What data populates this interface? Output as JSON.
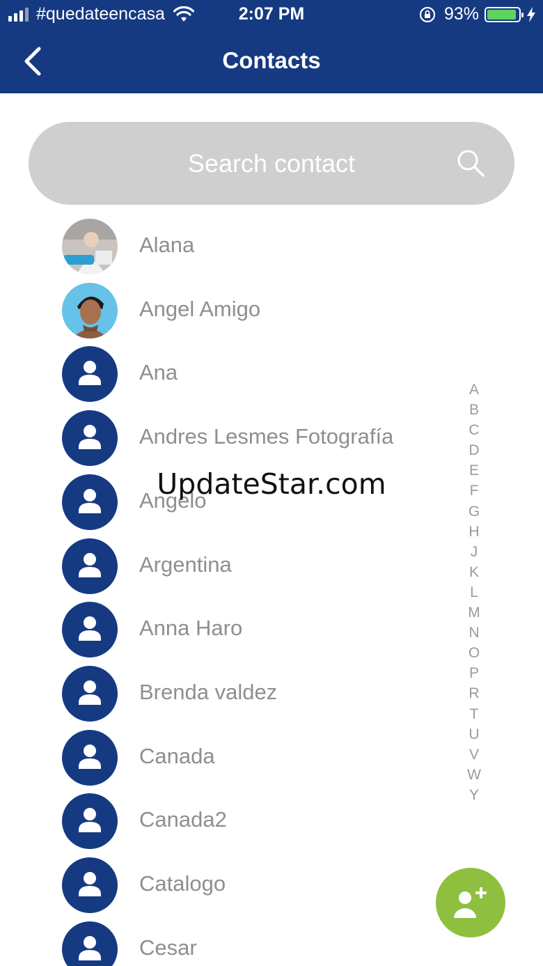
{
  "status_bar": {
    "carrier": "#quedateencasa",
    "time": "2:07 PM",
    "battery": "93%",
    "battery_level": 0.93
  },
  "header": {
    "title": "Contacts"
  },
  "search": {
    "placeholder": "Search contact"
  },
  "contacts": [
    {
      "name": "Alana",
      "avatar": "photo-baby"
    },
    {
      "name": "Angel Amigo",
      "avatar": "photo-man"
    },
    {
      "name": "Ana",
      "avatar": "default-person-icon"
    },
    {
      "name": "Andres Lesmes Fotografía",
      "avatar": "default-person-icon"
    },
    {
      "name": "Angelo",
      "avatar": "default-person-icon"
    },
    {
      "name": "Argentina",
      "avatar": "default-person-icon"
    },
    {
      "name": "Anna Haro",
      "avatar": "default-person-icon"
    },
    {
      "name": "Brenda valdez",
      "avatar": "default-person-icon"
    },
    {
      "name": "Canada",
      "avatar": "default-person-icon"
    },
    {
      "name": "Canada2",
      "avatar": "default-person-icon"
    },
    {
      "name": "Catalogo",
      "avatar": "default-person-icon"
    },
    {
      "name": "Cesar",
      "avatar": "default-person-icon"
    }
  ],
  "alphabet_index": [
    "A",
    "B",
    "C",
    "D",
    "E",
    "F",
    "G",
    "H",
    "J",
    "K",
    "L",
    "M",
    "N",
    "O",
    "P",
    "R",
    "T",
    "U",
    "V",
    "W",
    "Y"
  ],
  "watermark": "UpdateStar.com",
  "fab": {
    "icon": "add-person-icon"
  },
  "colors": {
    "header": "#163a82",
    "accent_green": "#8ebf3f",
    "search_bg": "#cfcfd0",
    "contact_text": "#8e8e93"
  }
}
